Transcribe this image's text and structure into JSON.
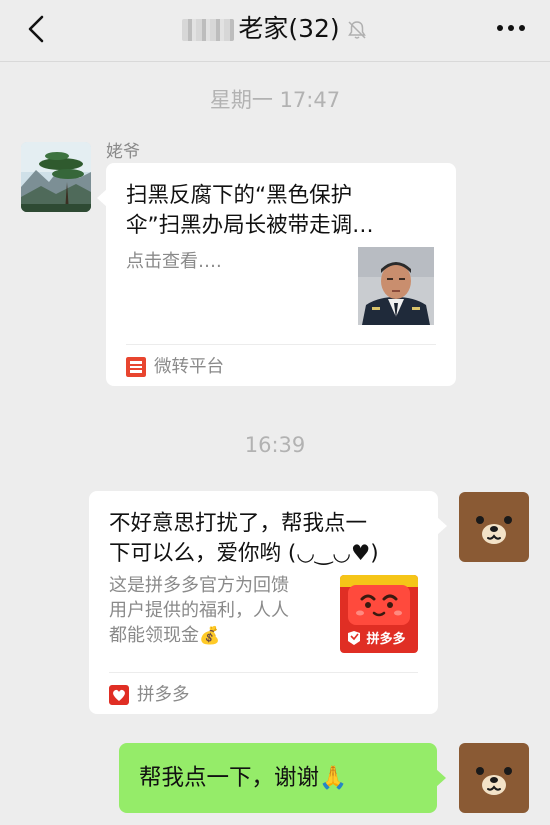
{
  "header": {
    "title": "老家(32)",
    "colors": {
      "background": "#ededed"
    }
  },
  "messages": {
    "time1": "星期一 17:47",
    "time2": "16:39",
    "sender1": "姥爷",
    "card1": {
      "title_line1": "扫黑反腐下的“黑色保护",
      "title_line2": "伞”扫黑办局长被带走调…",
      "desc": "点击查看….",
      "source": "微转平台"
    },
    "card2": {
      "title_line1": "不好意思打扰了，帮我点一",
      "title_line2": "下可以么，爱你哟 (◡‿◡♥)",
      "desc_line1": "这是拼多多官方为回馈",
      "desc_line2": "用户提供的福利，人人",
      "desc_line3": "都能领现金",
      "desc_emoji": "💰",
      "thumb_label": "拼多多",
      "source": "拼多多"
    },
    "green": {
      "text": "帮我点一下，谢谢",
      "emoji": "🙏",
      "color": "#95ec69"
    }
  }
}
